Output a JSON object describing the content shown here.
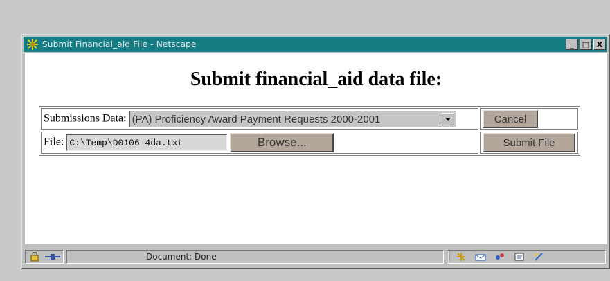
{
  "window": {
    "title": "Submit Financial_aid File - Netscape",
    "buttons": {
      "minimize": "_",
      "maximize": "□",
      "close": "X"
    }
  },
  "page": {
    "heading": "Submit financial_aid data file:"
  },
  "form": {
    "submissions_label": "Submissions Data:",
    "submissions_selected": "(PA) Proficiency Award Payment Requests 2000-2001",
    "cancel_label": "Cancel",
    "file_label": "File:",
    "file_value": "C:\\Temp\\D0106 4da.txt",
    "browse_label": "Browse...",
    "submit_label": "Submit File"
  },
  "statusbar": {
    "status_text": "Document: Done",
    "icons": [
      "security-icon",
      "connection-icon",
      "component-icon",
      "mail-icon",
      "discussion-icon",
      "composer-icon",
      "edit-icon"
    ]
  },
  "colors": {
    "titlebar": "#157c83",
    "button_face": "#b3a79b",
    "chrome": "#c0c0c0"
  }
}
